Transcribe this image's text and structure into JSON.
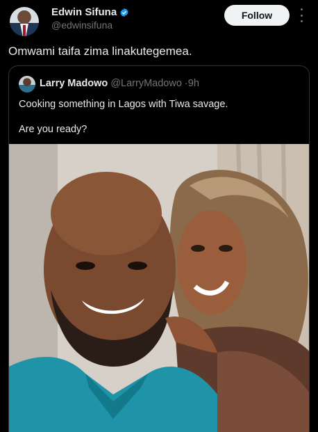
{
  "author": {
    "display_name": "Edwin Sifuna",
    "handle": "@edwinsifuna",
    "verified": true
  },
  "follow_button": {
    "label": "Follow"
  },
  "more_menu": {
    "icon": "more-vertical-icon"
  },
  "tweet": {
    "text": "Omwami taifa zima linakutegemea."
  },
  "quoted_tweet": {
    "author_name": "Larry Madowo",
    "author_handle": "@LarryMadowo",
    "separator": "·",
    "time": "9h",
    "text_line1": "Cooking something in Lagos with Tiwa savage.",
    "text_line2": "Are you ready?"
  },
  "colors": {
    "background": "#000000",
    "text_primary": "#e7e9ea",
    "text_secondary": "#71767b",
    "verified_blue": "#1d9bf0",
    "follow_bg": "#eff3f4",
    "border": "#2f3336"
  }
}
